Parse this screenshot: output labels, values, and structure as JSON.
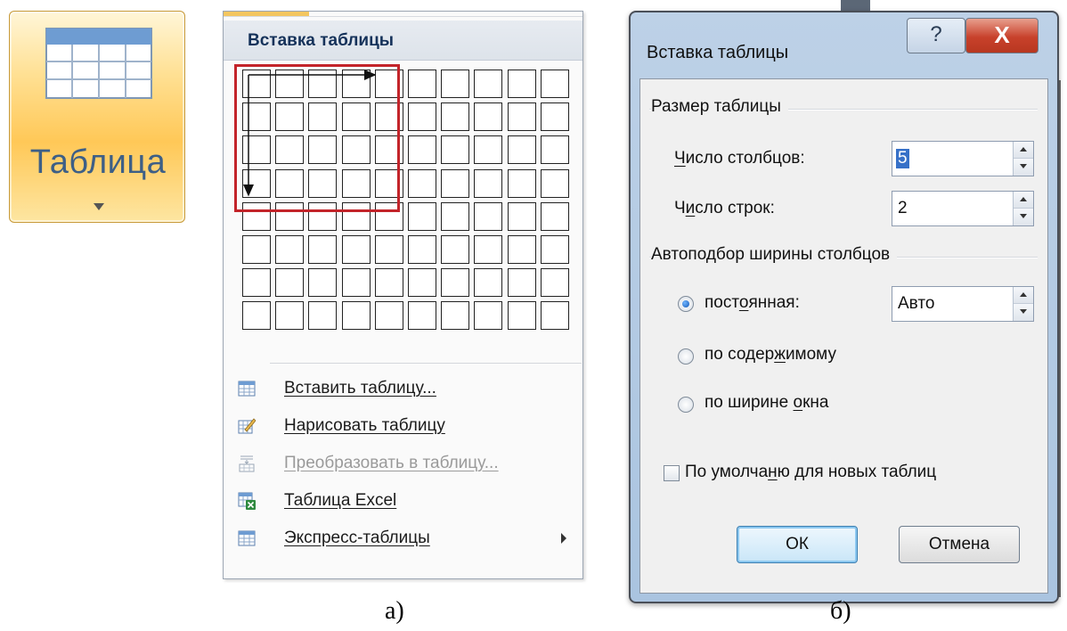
{
  "ribbon_button": {
    "label": "Таблица",
    "icon": "table-icon"
  },
  "insert_menu": {
    "header": "Вставка таблицы",
    "grid": {
      "columns": 10,
      "rows": 8,
      "selected_columns": 5,
      "selected_rows": 4
    },
    "items": [
      {
        "label": "Вставить таблицу...",
        "icon": "insert-table-icon",
        "enabled": true,
        "submenu": false
      },
      {
        "label": "Нарисовать таблицу",
        "icon": "draw-table-icon",
        "enabled": true,
        "submenu": false
      },
      {
        "label": "Преобразовать в таблицу...",
        "icon": "convert-to-table-icon",
        "enabled": false,
        "submenu": false
      },
      {
        "label": "Таблица Excel",
        "icon": "excel-table-icon",
        "enabled": true,
        "submenu": false
      },
      {
        "label": "Экспресс-таблицы",
        "icon": "quick-tables-icon",
        "enabled": true,
        "submenu": true
      }
    ]
  },
  "dialog": {
    "title": "Вставка таблицы",
    "help_button": "?",
    "close_button": "X",
    "table_size": {
      "group_label": "Размер таблицы",
      "columns_label": "Число столбцов:",
      "columns_value": "5",
      "rows_label": "Число строк:",
      "rows_value": "2"
    },
    "autofit": {
      "group_label": "Автоподбор ширины столбцов",
      "options": [
        {
          "label": "постоянная:",
          "selected": true
        },
        {
          "label": "по содержимому",
          "selected": false
        },
        {
          "label": "по ширине окна",
          "selected": false
        }
      ],
      "fixed_width_value": "Авто"
    },
    "default_checkbox": {
      "label": "По умолчанию для новых таблиц",
      "checked": false
    },
    "ok_button": "ОК",
    "cancel_button": "Отмена"
  },
  "captions": {
    "left": "а)",
    "right": "б)"
  },
  "colors": {
    "selection_frame": "#c3242a",
    "ribbon_label": "#3d5f86",
    "dialog_frame": "#aac4e0"
  }
}
